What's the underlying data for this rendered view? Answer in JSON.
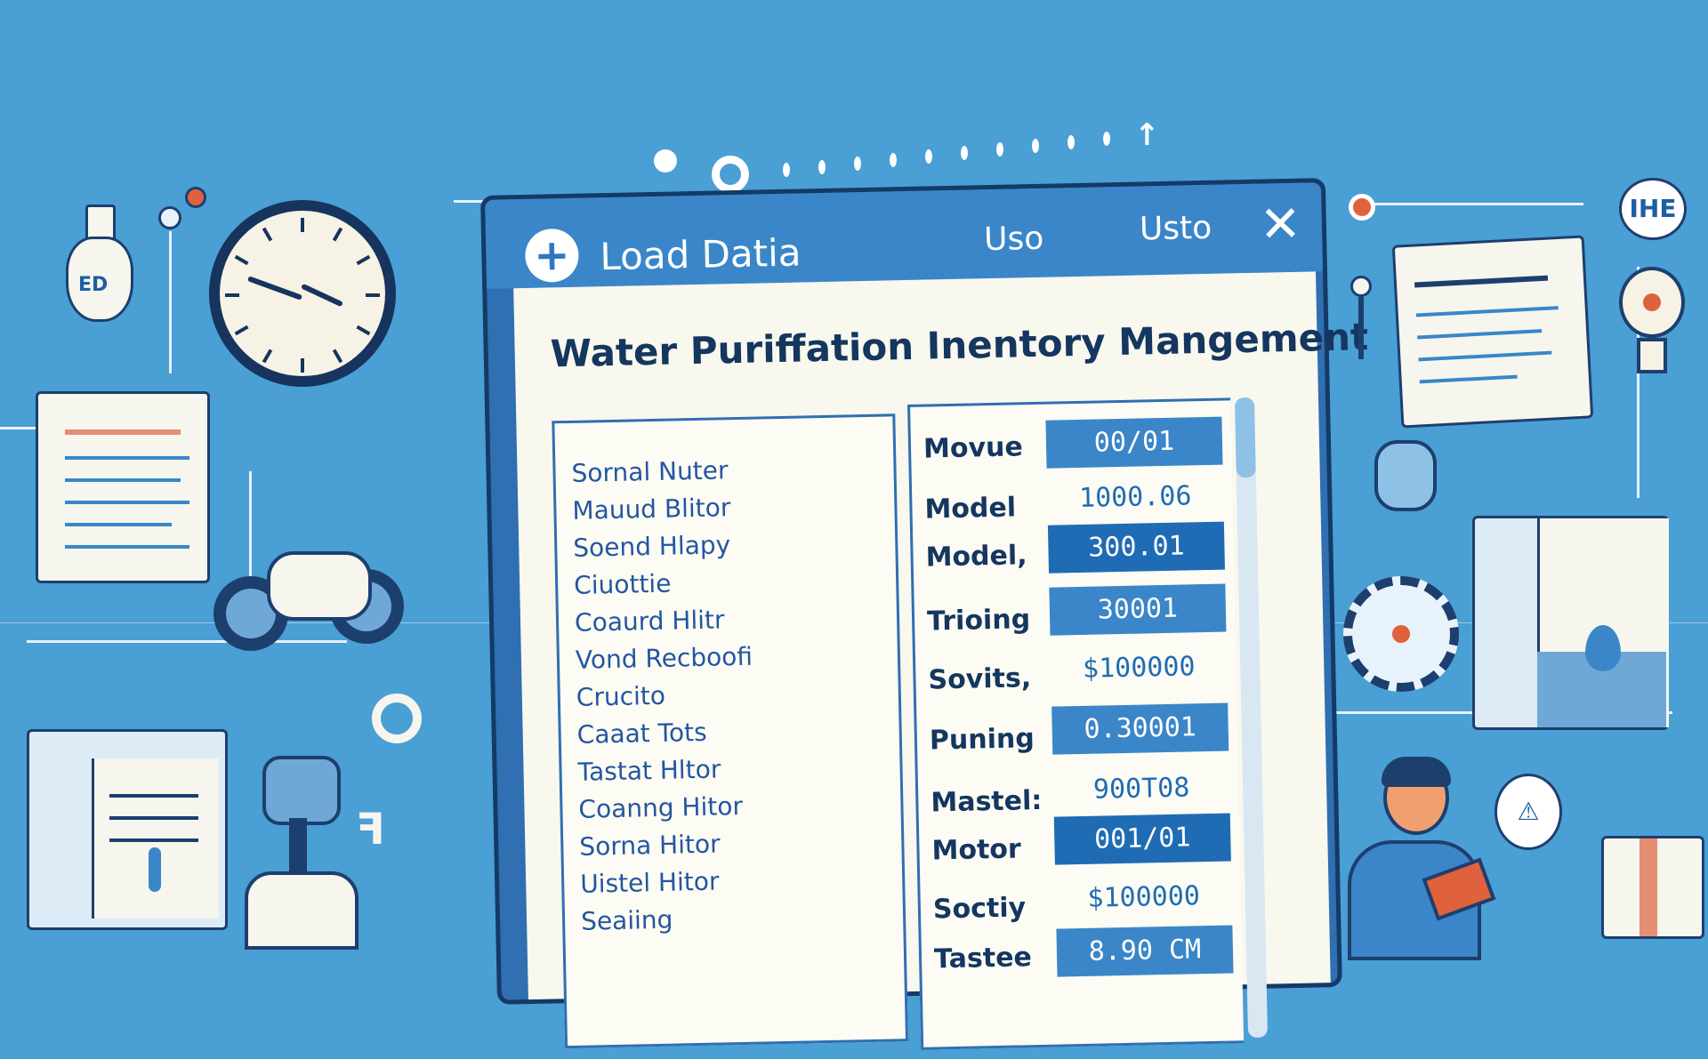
{
  "window": {
    "title": "Load Datia",
    "menu": [
      "Uso",
      "Usto"
    ],
    "add_icon": "plus-icon",
    "close_icon": "close-icon"
  },
  "page_title": "Water Puriffation Inentory Mangement",
  "left_list": [
    "Sornal Nuter",
    "Mauud Blitor",
    "Soend Hlapy",
    "Ciuottie",
    "Coaurd Hlitr",
    "Vond Recboofi",
    "Crucito",
    "Caaat Tots",
    "Tastat Hltor",
    "Coanng Hitor",
    "Sorna Hitor",
    "Uistel Hitor",
    "Seaiing"
  ],
  "table_rows": [
    {
      "label": "Movue",
      "value": "00/01"
    },
    {
      "label": "Model",
      "value": "1000.06"
    },
    {
      "label": "Model,",
      "value": "300.01"
    },
    {
      "label": "Trioing",
      "value": "30001"
    },
    {
      "label": "Sovits,",
      "value": "$100000"
    },
    {
      "label": "Puning",
      "value": "0.30001"
    },
    {
      "label": "Mastel:",
      "value": "900T08"
    },
    {
      "label": "Motor",
      "value": "001/01"
    },
    {
      "label": "Soctiy",
      "value": "$100000"
    },
    {
      "label": "Tastee",
      "value": "8.90 CM"
    }
  ],
  "decor": {
    "corner_badge": "IHE",
    "bulb_label": "ED"
  },
  "colors": {
    "background": "#4a9fd4",
    "window_frame": "#143a66",
    "titlebar": "#3a86c8",
    "value_cell": "#3a86c8",
    "value_cell_alt": "#1f6cb5",
    "content_bg": "#f8f8ee"
  }
}
